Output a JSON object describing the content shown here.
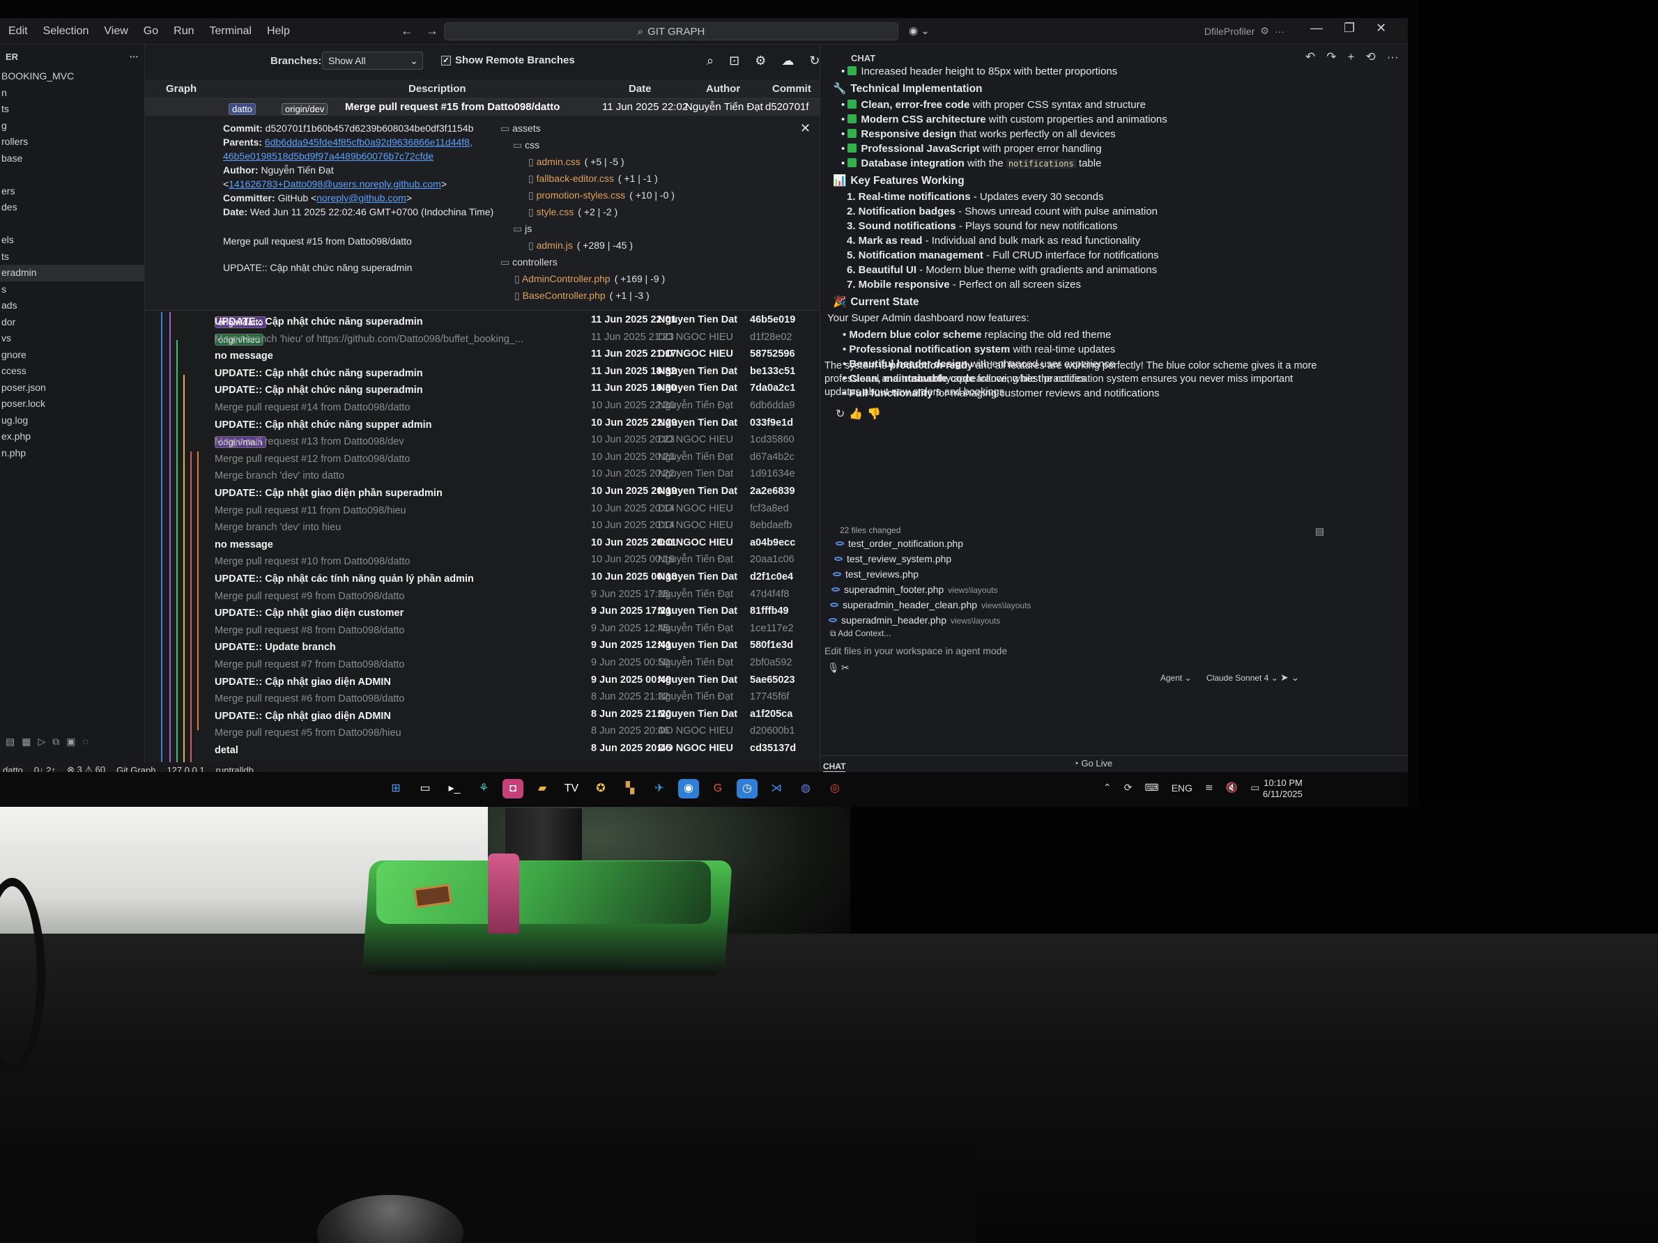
{
  "menu": [
    "Edit",
    "Selection",
    "View",
    "Go",
    "Run",
    "Terminal",
    "Help"
  ],
  "command_center": "GIT GRAPH",
  "profile_name": "DfileProfiler",
  "explorer": {
    "header": "ER",
    "items": [
      "BOOKING_MVC",
      "n",
      "ts",
      "g",
      "rollers",
      "base",
      "",
      "ers",
      "des",
      "",
      "els",
      "ts",
      "eradmin",
      "s",
      "ads",
      "dor",
      "vs",
      "gnore",
      "ccess",
      "poser.json",
      "poser.lock",
      "ug.log",
      "ex.php",
      "n.php"
    ]
  },
  "gitgraph": {
    "branches_label": "Branches:",
    "branches_value": "Show All",
    "show_remote_label": "Show Remote Branches",
    "columns": {
      "graph": "Graph",
      "description": "Description",
      "date": "Date",
      "author": "Author",
      "commit": "Commit"
    },
    "selected": {
      "badge1": "datto",
      "badge2": "origin/dev",
      "description": "Merge pull request #15 from Datto098/datto",
      "date": "11 Jun 2025 22:02",
      "author": "Nguyễn Tiến Đạt",
      "hash": "d520701f"
    },
    "details": {
      "commit_label": "Commit:",
      "commit_value": "d520701f1b60b457d6239b608034be0df3f1154b",
      "parents_label": "Parents:",
      "parent1": "6db6dda945fde4f85cfb0a92d9636866e11d44f8,",
      "parent2": "46b5e0198518d5bd9f97a4489b60076b7c72cfde",
      "author_label": "Author:",
      "author_value": "Nguyễn Tiến Đạt",
      "author_email": "141626783+Datto098@users.noreply.github.com",
      "committer_label": "Committer:",
      "committer_value": "GitHub",
      "committer_email": "noreply@github.com",
      "date_label": "Date:",
      "date_value": "Wed Jun 11 2025 22:02:46 GMT+0700 (Indochina Time)",
      "message1": "Merge pull request #15 from Datto098/datto",
      "message2": "UPDATE:: Cập nhật chức năng superadmin",
      "files": [
        {
          "type": "folder",
          "name": "assets",
          "stat": ""
        },
        {
          "type": "folder",
          "name": "css",
          "stat": ""
        },
        {
          "type": "file",
          "name": "admin.css",
          "stat": "( +5 | -5 )"
        },
        {
          "type": "file",
          "name": "fallback-editor.css",
          "stat": "( +1 | -1 )"
        },
        {
          "type": "file",
          "name": "promotion-styles.css",
          "stat": "( +10 | -0 )"
        },
        {
          "type": "file",
          "name": "style.css",
          "stat": "( +2 | -2 )"
        },
        {
          "type": "folder",
          "name": "js",
          "stat": ""
        },
        {
          "type": "file",
          "name": "admin.js",
          "stat": "( +289 | -45 )"
        },
        {
          "type": "folder",
          "name": "controllers",
          "stat": ""
        },
        {
          "type": "file",
          "name": "AdminController.php",
          "stat": "( +169 | -9 )"
        },
        {
          "type": "file",
          "name": "BaseController.php",
          "stat": "( +1 | -3 )"
        }
      ]
    },
    "commits": [
      {
        "badges": [
          "origin/datto"
        ],
        "desc": "UPDATE:: Cập nhật chức năng superadmin",
        "date": "11 Jun 2025 22:01",
        "author": "Nguyen Tien Dat",
        "hash": "46b5e019",
        "style": "bright"
      },
      {
        "badges": [
          "origin/hieu"
        ],
        "desc": "Merge branch 'hieu' of https://github.com/Datto098/buffet_booking_...",
        "date": "11 Jun 2025 21:23",
        "author": "DO NGOC HIEU",
        "hash": "d1f28e02",
        "style": "dim"
      },
      {
        "badges": [],
        "desc": "no message",
        "date": "11 Jun 2025 21:17",
        "author": "DO NGOC HIEU",
        "hash": "58752596",
        "style": "bright"
      },
      {
        "badges": [],
        "desc": "UPDATE:: Cập nhật chức năng superadmin",
        "date": "11 Jun 2025 18:32",
        "author": "Nguyen Tien Dat",
        "hash": "be133c51",
        "style": "bright"
      },
      {
        "badges": [],
        "desc": "UPDATE:: Cập nhật chức năng superadmin",
        "date": "11 Jun 2025 18:30",
        "author": "Nguyen Tien Dat",
        "hash": "7da0a2c1",
        "style": "bright"
      },
      {
        "badges": [],
        "desc": "Merge pull request #14 from Datto098/datto",
        "date": "10 Jun 2025 22:30",
        "author": "Nguyễn Tiến Đạt",
        "hash": "6db6dda9",
        "style": "dim"
      },
      {
        "badges": [],
        "desc": "UPDATE:: Cập nhật chức năng supper admin",
        "date": "10 Jun 2025 22:29",
        "author": "Nguyen Tien Dat",
        "hash": "033f9e1d",
        "style": "bright"
      },
      {
        "badges": [
          "origin/main"
        ],
        "desc": "Merge pull request #13 from Datto098/dev",
        "date": "10 Jun 2025 20:23",
        "author": "DO NGOC HIEU",
        "hash": "1cd35860",
        "style": "dim"
      },
      {
        "badges": [],
        "desc": "Merge pull request #12 from Datto098/datto",
        "date": "10 Jun 2025 20:23",
        "author": "Nguyễn Tiến Đạt",
        "hash": "d67a4b2c",
        "style": "dim"
      },
      {
        "badges": [],
        "desc": "Merge branch 'dev' into datto",
        "date": "10 Jun 2025 20:22",
        "author": "Nguyen Tien Dat",
        "hash": "1d91634e",
        "style": "dim"
      },
      {
        "badges": [],
        "desc": "UPDATE:: Cập nhật giao diện phần superadmin",
        "date": "10 Jun 2025 20:19",
        "author": "Nguyen Tien Dat",
        "hash": "2a2e6839",
        "style": "bright"
      },
      {
        "badges": [],
        "desc": "Merge pull request #11 from Datto098/hieu",
        "date": "10 Jun 2025 20:14",
        "author": "DO NGOC HIEU",
        "hash": "fcf3a8ed",
        "style": "dim"
      },
      {
        "badges": [],
        "desc": "Merge branch 'dev' into hieu",
        "date": "10 Jun 2025 20:14",
        "author": "DO NGOC HIEU",
        "hash": "8ebdaefb",
        "style": "dim"
      },
      {
        "badges": [],
        "desc": "no message",
        "date": "10 Jun 2025 20:11",
        "author": "DO NGOC HIEU",
        "hash": "a04b9ecc",
        "style": "bright"
      },
      {
        "badges": [],
        "desc": "Merge pull request #10 from Datto098/datto",
        "date": "10 Jun 2025 00:19",
        "author": "Nguyễn Tiến Đạt",
        "hash": "20aa1c06",
        "style": "dim"
      },
      {
        "badges": [],
        "desc": "UPDATE:: Cập nhật các tính năng quản lý phần admin",
        "date": "10 Jun 2025 00:18",
        "author": "Nguyen Tien Dat",
        "hash": "d2f1c0e4",
        "style": "bright"
      },
      {
        "badges": [],
        "desc": "Merge pull request #9 from Datto098/datto",
        "date": "9 Jun 2025 17:25",
        "author": "Nguyễn Tiến Đạt",
        "hash": "47d4f4f8",
        "style": "dim"
      },
      {
        "badges": [],
        "desc": "UPDATE:: Cập nhật giao diện customer",
        "date": "9 Jun 2025 17:21",
        "author": "Nguyen Tien Dat",
        "hash": "81fffb49",
        "style": "bright"
      },
      {
        "badges": [],
        "desc": "Merge pull request #8 from Datto098/datto",
        "date": "9 Jun 2025 12:45",
        "author": "Nguyễn Tiến Đạt",
        "hash": "1ce117e2",
        "style": "dim"
      },
      {
        "badges": [],
        "desc": "UPDATE:: Update branch",
        "date": "9 Jun 2025 12:41",
        "author": "Nguyen Tien Dat",
        "hash": "580f1e3d",
        "style": "bright"
      },
      {
        "badges": [],
        "desc": "Merge pull request #7 from Datto098/datto",
        "date": "9 Jun 2025 00:50",
        "author": "Nguyễn Tiến Đạt",
        "hash": "2bf0a592",
        "style": "dim"
      },
      {
        "badges": [],
        "desc": "UPDATE:: Cập nhật giao diện ADMIN",
        "date": "9 Jun 2025 00:49",
        "author": "Nguyen Tien Dat",
        "hash": "5ae65023",
        "style": "bright"
      },
      {
        "badges": [],
        "desc": "Merge pull request #6 from Datto098/datto",
        "date": "8 Jun 2025 21:22",
        "author": "Nguyễn Tiến Đạt",
        "hash": "17745f6f",
        "style": "dim"
      },
      {
        "badges": [],
        "desc": "UPDATE:: Cập nhật giao diện ADMIN",
        "date": "8 Jun 2025 21:20",
        "author": "Nguyen Tien Dat",
        "hash": "a1f205ca",
        "style": "bright"
      },
      {
        "badges": [],
        "desc": "Merge pull request #5 from Datto098/hieu",
        "date": "8 Jun 2025 20:46",
        "author": "DO NGOC HIEU",
        "hash": "d20600b1",
        "style": "dim"
      },
      {
        "badges": [],
        "desc": "detal",
        "date": "8 Jun 2025 20:45",
        "author": "DO NGOC HIEU",
        "hash": "cd35137d",
        "style": "bright"
      }
    ]
  },
  "statusbar": [
    "datto",
    "0↓ 2↑",
    "⊗ 3 ⚠ 60",
    "Git Graph",
    "127.0.0.1",
    "runtralldb"
  ],
  "chat": {
    "title": "CHAT",
    "lines": [
      {
        "kind": "bullet-green",
        "bold": "",
        "text": "Increased header height to 85px with better proportions"
      },
      {
        "kind": "heading",
        "icon": "🔧",
        "text": "Technical Implementation"
      },
      {
        "kind": "bullet-green",
        "bold": "Clean, error-free code",
        "text": " with proper CSS syntax and structure"
      },
      {
        "kind": "bullet-green",
        "bold": "Modern CSS architecture",
        "text": " with custom properties and animations"
      },
      {
        "kind": "bullet-green",
        "bold": "Responsive design",
        "text": " that works perfectly on all devices"
      },
      {
        "kind": "bullet-green",
        "bold": "Professional JavaScript",
        "text": " with proper error handling"
      },
      {
        "kind": "bullet-green-code",
        "bold": "Database integration",
        "text": " with the ",
        "code": "notifications",
        "after": " table"
      },
      {
        "kind": "heading",
        "icon": "📊",
        "text": "Key Features Working"
      },
      {
        "kind": "num",
        "bold": "1. Real-time notifications",
        "text": " - Updates every 30 seconds"
      },
      {
        "kind": "num",
        "bold": "2. Notification badges",
        "text": " - Shows unread count with pulse animation"
      },
      {
        "kind": "num",
        "bold": "3. Sound notifications",
        "text": " - Plays sound for new notifications"
      },
      {
        "kind": "num",
        "bold": "4. Mark as read",
        "text": " - Individual and bulk mark as read functionality"
      },
      {
        "kind": "num",
        "bold": "5. Notification management",
        "text": " - Full CRUD interface for notifications"
      },
      {
        "kind": "num",
        "bold": "6. Beautiful UI",
        "text": " - Modern blue theme with gradients and animations"
      },
      {
        "kind": "num",
        "bold": "7. Mobile responsive",
        "text": " - Perfect on all screen sizes"
      },
      {
        "kind": "heading",
        "icon": "🎉",
        "text": "Current State"
      },
      {
        "kind": "para",
        "bold": "",
        "text": "Your Super Admin dashboard now features:"
      },
      {
        "kind": "bullet",
        "bold": "Modern blue color scheme",
        "text": " replacing the old red theme"
      },
      {
        "kind": "bullet",
        "bold": "Professional notification system",
        "text": " with real-time updates"
      },
      {
        "kind": "bullet",
        "bold": "Beautiful header design",
        "text": " with enhanced user experience"
      },
      {
        "kind": "bullet",
        "bold": "Clean, maintainable code",
        "text": " following best practices"
      },
      {
        "kind": "bullet",
        "bold": "Full functionality",
        "text": " for managing customer reviews and notifications"
      }
    ],
    "summary": "The system is production-ready and all features are working perfectly! The blue color scheme gives it a more professional and trustworthy appearance, while the notification system ensures you never miss important updates about new orders and bookings.",
    "summary_bold": "production-ready",
    "files_changed": "22 files changed",
    "files": [
      {
        "name": "test_order_notification.php",
        "path": ""
      },
      {
        "name": "test_review_system.php",
        "path": ""
      },
      {
        "name": "test_reviews.php",
        "path": ""
      },
      {
        "name": "superadmin_footer.php",
        "path": "views\\layouts"
      },
      {
        "name": "superadmin_header_clean.php",
        "path": "views\\layouts"
      },
      {
        "name": "superadmin_header.php",
        "path": "views\\layouts"
      }
    ],
    "add_context": "Add Context...",
    "input_placeholder": "Edit files in your workspace in agent mode",
    "mode": "Agent",
    "model": "Claude Sonnet 4",
    "footer_tab": "CHAT"
  },
  "tray": {
    "golive": "Go Live",
    "lang": "ENG",
    "time": "10:10 PM",
    "date": "6/11/2025"
  },
  "colors": {
    "accent": "#3b8eea",
    "green": "#2fb24a",
    "file_orange": "#e0a15e"
  }
}
